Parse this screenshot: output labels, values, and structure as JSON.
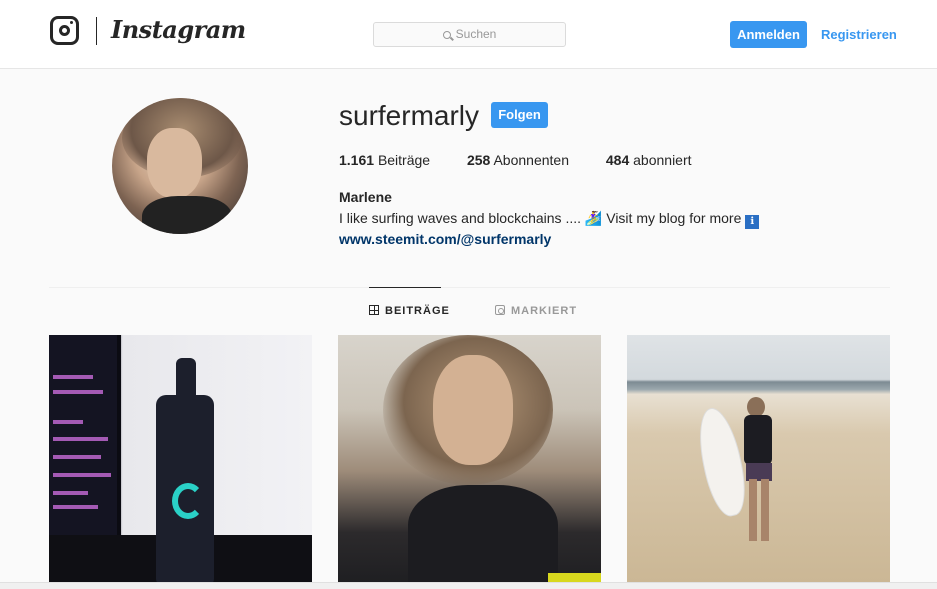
{
  "header": {
    "logo_icon": "instagram-camera-icon",
    "wordmark": "Instagram",
    "search": {
      "icon": "search-icon",
      "placeholder": "Suchen"
    },
    "login_label": "Anmelden",
    "register_label": "Registrieren",
    "accent_color": "#3897f0"
  },
  "profile": {
    "username": "surfermarly",
    "follow_label": "Folgen",
    "stats": {
      "posts_count": "1.161",
      "posts_label": "Beiträge",
      "followers_count": "258",
      "followers_label": "Abonnenten",
      "following_count": "484",
      "following_label": "abonniert"
    },
    "full_name": "Marlene",
    "bio_text": "I like surfing waves and blockchains ....",
    "bio_emojis": "🏄‍♀️",
    "bio_text_2": "Visit my blog for more",
    "bio_info_badge": "ℹ",
    "website": "www.steemit.com/@surfermarly"
  },
  "tabs": [
    {
      "label": "BEITRÄGE",
      "icon": "grid-icon",
      "active": true
    },
    {
      "label": "MARKIERT",
      "icon": "tagged-icon",
      "active": false
    }
  ],
  "posts": [
    {
      "subject": "steemit-water-bottle"
    },
    {
      "subject": "selfie-portrait"
    },
    {
      "subject": "beach-surfboard"
    }
  ]
}
